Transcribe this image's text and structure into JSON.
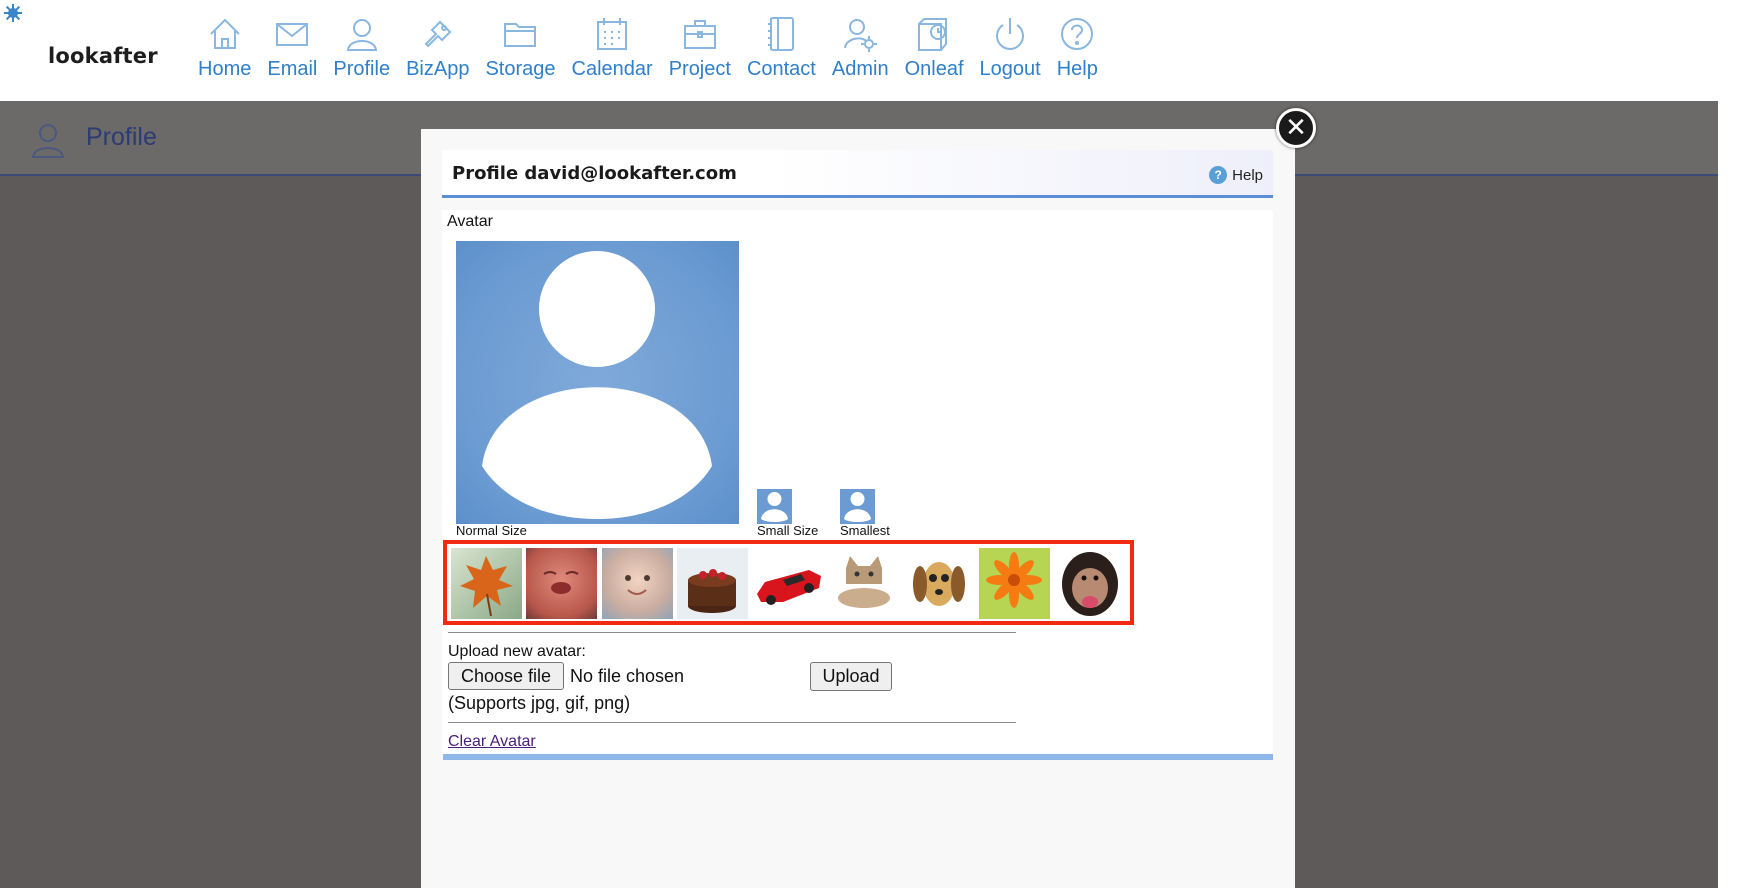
{
  "app": {
    "logo": "lookafter"
  },
  "nav": {
    "items": [
      {
        "label": "Home",
        "icon": "home-icon"
      },
      {
        "label": "Email",
        "icon": "email-icon"
      },
      {
        "label": "Profile",
        "icon": "profile-icon"
      },
      {
        "label": "BizApp",
        "icon": "bizapp-icon"
      },
      {
        "label": "Storage",
        "icon": "storage-icon"
      },
      {
        "label": "Calendar",
        "icon": "calendar-icon"
      },
      {
        "label": "Project",
        "icon": "project-icon"
      },
      {
        "label": "Contact",
        "icon": "contact-icon"
      },
      {
        "label": "Admin",
        "icon": "admin-icon"
      },
      {
        "label": "Onleaf",
        "icon": "onleaf-icon"
      },
      {
        "label": "Logout",
        "icon": "logout-icon"
      },
      {
        "label": "Help",
        "icon": "help-icon"
      }
    ]
  },
  "page": {
    "title": "Profile"
  },
  "modal": {
    "title": "Profile david@lookafter.com",
    "help_label": "Help",
    "close_symbol": "✕",
    "avatar_caption": "Avatar",
    "sizes": {
      "normal": "Normal Size",
      "small": "Small Size",
      "smallest": "Smallest"
    },
    "gallery": [
      {
        "name": "autumn-leaf"
      },
      {
        "name": "crying-baby"
      },
      {
        "name": "smiling-baby"
      },
      {
        "name": "chocolate-cake"
      },
      {
        "name": "red-sports-car"
      },
      {
        "name": "kitten"
      },
      {
        "name": "puppy"
      },
      {
        "name": "orange-gerbera"
      },
      {
        "name": "chimpanzee"
      }
    ],
    "upload": {
      "label": "Upload new avatar:",
      "choose_file_label": "Choose file",
      "file_status": "No file chosen",
      "upload_button": "Upload",
      "supports": "(Supports jpg, gif, png)"
    },
    "clear_avatar": "Clear Avatar"
  },
  "colors": {
    "nav_label": "#2f7fc9",
    "nav_icon": "#8ab7e0",
    "overlay": "#5e5a59",
    "gallery_border": "#f22a13",
    "avatar_bg": "#6b9bd2",
    "accent_bar": "#8fb7e8"
  }
}
